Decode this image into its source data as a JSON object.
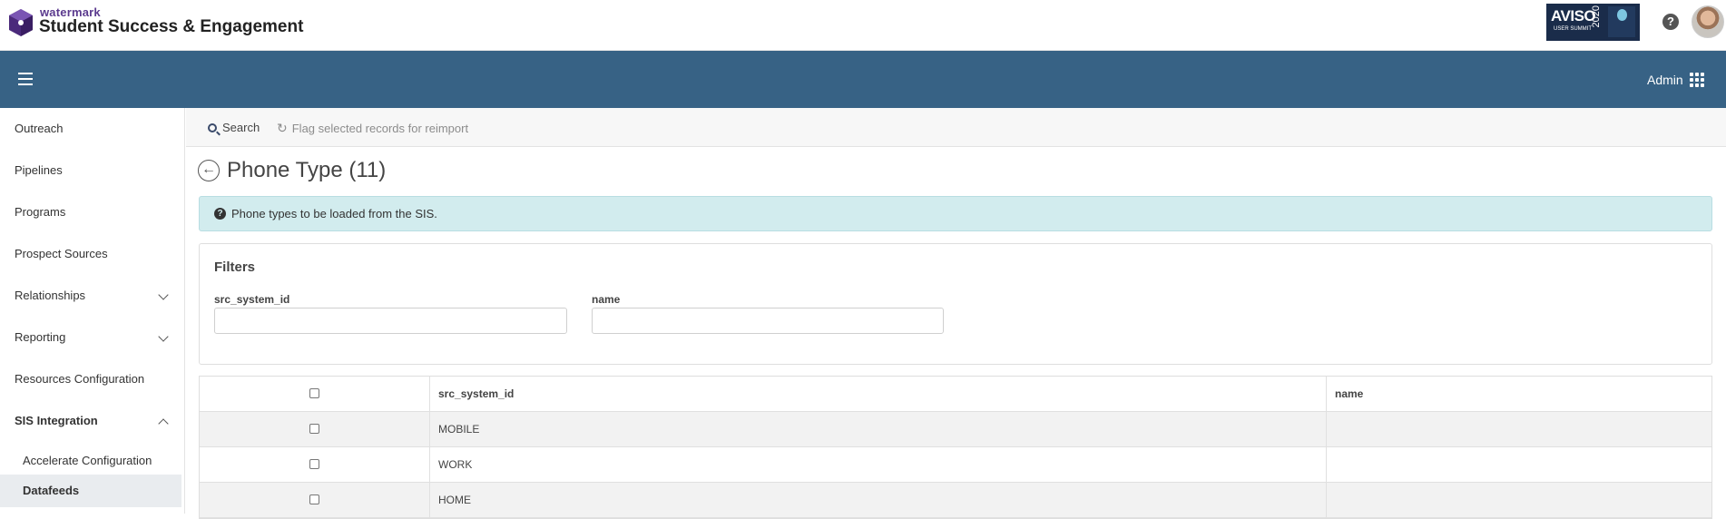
{
  "header": {
    "brand_small": "watermark",
    "brand_title": "Student Success & Engagement",
    "banner": {
      "title": "AVISO",
      "year": "2020",
      "subtitle": "USER SUMMIT"
    }
  },
  "navbar": {
    "admin_label": "Admin"
  },
  "sidebar": {
    "items": [
      {
        "label": "Outreach"
      },
      {
        "label": "Pipelines"
      },
      {
        "label": "Programs"
      },
      {
        "label": "Prospect Sources"
      },
      {
        "label": "Relationships"
      },
      {
        "label": "Reporting"
      },
      {
        "label": "Resources Configuration"
      },
      {
        "label": "SIS Integration"
      },
      {
        "label": "Accelerate Configuration"
      },
      {
        "label": "Datafeeds"
      }
    ]
  },
  "toolbar": {
    "search_label": "Search",
    "flag_label": "Flag selected records for reimport"
  },
  "page": {
    "title": "Phone Type (11)",
    "info": "Phone types to be loaded from the SIS."
  },
  "filters": {
    "heading": "Filters",
    "field1_label": "src_system_id",
    "field1_value": "",
    "field2_label": "name",
    "field2_value": ""
  },
  "table": {
    "columns": [
      "",
      "src_system_id",
      "name"
    ],
    "rows": [
      {
        "src_system_id": "MOBILE",
        "name": ""
      },
      {
        "src_system_id": "WORK",
        "name": ""
      },
      {
        "src_system_id": "HOME",
        "name": ""
      }
    ]
  },
  "colors": {
    "navbar": "#376285",
    "info_bg": "#d2ecee",
    "brand_purple": "#5b3a8e"
  }
}
